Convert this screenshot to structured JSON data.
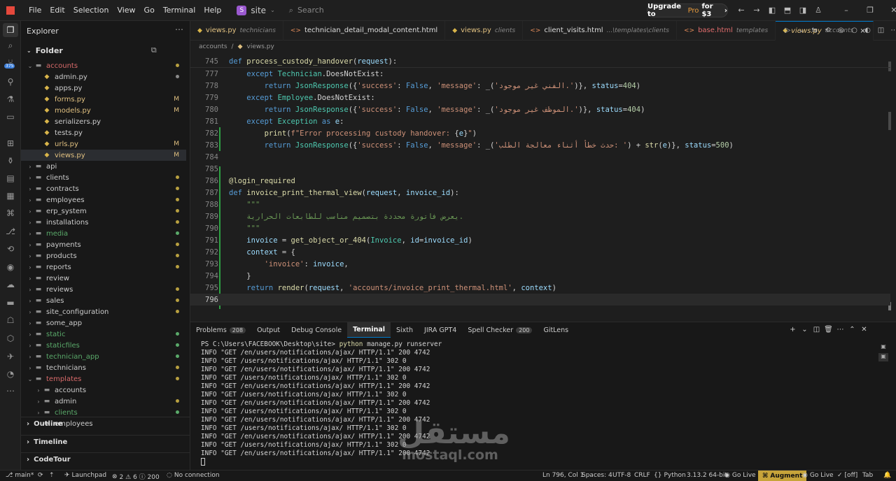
{
  "titlebar": {
    "menu": [
      "File",
      "Edit",
      "Selection",
      "View",
      "Go",
      "Terminal",
      "Help"
    ],
    "project_badge": "S",
    "project_name": "site",
    "search_placeholder": "Search",
    "upgrade_prefix": "Upgrade to",
    "upgrade_pro": "Pro",
    "upgrade_suffix": "for $3"
  },
  "activity": {
    "badge_count": "375"
  },
  "sidebar": {
    "title": "Explorer",
    "folder_label": "Folder",
    "rows": [
      {
        "name": "accounts",
        "type": "folder",
        "open": true,
        "indent": 1,
        "color": "#d86a6a",
        "status": "dot",
        "status_color": "#b8a040"
      },
      {
        "name": "admin.py",
        "type": "py",
        "indent": 2,
        "color": "#ccc",
        "status": "dot",
        "status_color": "#8a8a8a"
      },
      {
        "name": "apps.py",
        "type": "py",
        "indent": 2,
        "color": "#ccc",
        "status": ""
      },
      {
        "name": "forms.py",
        "type": "py",
        "indent": 2,
        "color": "#e0c080",
        "status": "M",
        "status_color": "#e0c080"
      },
      {
        "name": "models.py",
        "type": "py",
        "indent": 2,
        "color": "#e0c080",
        "status": "M",
        "status_color": "#e0c080"
      },
      {
        "name": "serializers.py",
        "type": "py",
        "indent": 2,
        "color": "#ccc",
        "status": ""
      },
      {
        "name": "tests.py",
        "type": "py",
        "indent": 2,
        "color": "#ccc",
        "status": ""
      },
      {
        "name": "urls.py",
        "type": "py",
        "indent": 2,
        "color": "#e0c080",
        "status": "M",
        "status_color": "#e0c080"
      },
      {
        "name": "views.py",
        "type": "py",
        "indent": 2,
        "color": "#e0c080",
        "status": "M",
        "status_color": "#e0c080",
        "selected": true
      },
      {
        "name": "api",
        "type": "folder",
        "indent": 1,
        "color": "#ccc",
        "status": ""
      },
      {
        "name": "clients",
        "type": "folder",
        "indent": 1,
        "color": "#ccc",
        "status": "dot",
        "status_color": "#b8a040"
      },
      {
        "name": "contracts",
        "type": "folder",
        "indent": 1,
        "color": "#ccc",
        "status": "dot",
        "status_color": "#b8a040"
      },
      {
        "name": "employees",
        "type": "folder",
        "indent": 1,
        "color": "#ccc",
        "status": "dot",
        "status_color": "#b8a040"
      },
      {
        "name": "erp_system",
        "type": "folder",
        "indent": 1,
        "color": "#ccc",
        "status": "dot",
        "status_color": "#b8a040"
      },
      {
        "name": "installations",
        "type": "folder",
        "indent": 1,
        "color": "#ccc",
        "status": "dot",
        "status_color": "#b8a040"
      },
      {
        "name": "media",
        "type": "folder",
        "indent": 1,
        "color": "#5aaa6a",
        "status": "dot",
        "status_color": "#5aaa6a"
      },
      {
        "name": "payments",
        "type": "folder",
        "indent": 1,
        "color": "#ccc",
        "status": "dot",
        "status_color": "#b8a040"
      },
      {
        "name": "products",
        "type": "folder",
        "indent": 1,
        "color": "#ccc",
        "status": "dot",
        "status_color": "#b8a040"
      },
      {
        "name": "reports",
        "type": "folder",
        "indent": 1,
        "color": "#ccc",
        "status": "dot",
        "status_color": "#b8a040"
      },
      {
        "name": "review",
        "type": "folder",
        "indent": 1,
        "color": "#ccc",
        "status": ""
      },
      {
        "name": "reviews",
        "type": "folder",
        "indent": 1,
        "color": "#ccc",
        "status": "dot",
        "status_color": "#b8a040"
      },
      {
        "name": "sales",
        "type": "folder",
        "indent": 1,
        "color": "#ccc",
        "status": "dot",
        "status_color": "#b8a040"
      },
      {
        "name": "site_configuration",
        "type": "folder",
        "indent": 1,
        "color": "#ccc",
        "status": "dot",
        "status_color": "#b8a040"
      },
      {
        "name": "some_app",
        "type": "folder",
        "indent": 1,
        "color": "#ccc",
        "status": ""
      },
      {
        "name": "static",
        "type": "folder",
        "indent": 1,
        "color": "#5aaa6a",
        "status": "dot",
        "status_color": "#5aaa6a"
      },
      {
        "name": "staticfiles",
        "type": "folder",
        "indent": 1,
        "color": "#5aaa6a",
        "status": "dot",
        "status_color": "#5aaa6a"
      },
      {
        "name": "technician_app",
        "type": "folder",
        "indent": 1,
        "color": "#5aaa6a",
        "status": "dot",
        "status_color": "#5aaa6a"
      },
      {
        "name": "technicians",
        "type": "folder",
        "indent": 1,
        "color": "#ccc",
        "status": "dot",
        "status_color": "#b8a040"
      },
      {
        "name": "templates",
        "type": "folder",
        "open": true,
        "indent": 1,
        "color": "#d86a6a",
        "status": "dot",
        "status_color": "#b8a040"
      },
      {
        "name": "accounts",
        "type": "folder",
        "indent": 2,
        "color": "#ccc",
        "status": ""
      },
      {
        "name": "admin",
        "type": "folder",
        "indent": 2,
        "color": "#ccc",
        "status": "dot",
        "status_color": "#b8a040"
      },
      {
        "name": "clients",
        "type": "folder",
        "indent": 2,
        "color": "#5aaa6a",
        "status": "dot",
        "status_color": "#5aaa6a"
      },
      {
        "name": "employees",
        "type": "folder",
        "indent": 2,
        "color": "#ccc",
        "status": ""
      }
    ],
    "sections": [
      "Outline",
      "Timeline",
      "CodeTour"
    ]
  },
  "tabs": [
    {
      "name": "views.py",
      "sub": "technicians",
      "color": "#e0c080",
      "icon": "py"
    },
    {
      "name": "technician_detail_modal_content.html",
      "sub": "",
      "color": "#ddd",
      "icon": "html"
    },
    {
      "name": "views.py",
      "sub": "clients",
      "color": "#e0c080",
      "icon": "py"
    },
    {
      "name": "client_visits.html",
      "sub": "...\\templates\\clients",
      "color": "#ddd",
      "icon": "html"
    },
    {
      "name": "base.html",
      "sub": "templates",
      "color": "#e06c6c",
      "icon": "html"
    },
    {
      "name": "views.py",
      "sub": "accounts",
      "color": "#e0c080",
      "icon": "py",
      "active": true,
      "close": "×"
    }
  ],
  "breadcrumb": [
    "accounts",
    "/",
    "views.py"
  ],
  "editor": {
    "lines": [
      {
        "n": "745",
        "html": "<span class='kw'>def</span> <span class='fn'>process_custody_handover</span>(<span class='var'>request</span>):",
        "sticky": true
      },
      {
        "n": "777",
        "html": "    <span class='kw'>except</span> <span class='cls'>Technician</span>.DoesNotExist:"
      },
      {
        "n": "778",
        "html": "        <span class='kw'>return</span> <span class='cls'>JsonResponse</span>({<span class='str'>'success'</span>: <span class='kw'>False</span>, <span class='str'>'message'</span>: _(<span class='str'>'الفني غير موجود.'</span>)}, <span class='var'>status</span>=<span class='num'>404</span>)"
      },
      {
        "n": "779",
        "html": "    <span class='kw'>except</span> <span class='cls'>Employee</span>.DoesNotExist:"
      },
      {
        "n": "780",
        "html": "        <span class='kw'>return</span> <span class='cls'>JsonResponse</span>({<span class='str'>'success'</span>: <span class='kw'>False</span>, <span class='str'>'message'</span>: _(<span class='str'>'الموظف غير موجود.'</span>)}, <span class='var'>status</span>=<span class='num'>404</span>)"
      },
      {
        "n": "781",
        "html": "    <span class='kw'>except</span> <span class='cls'>Exception</span> <span class='kw'>as</span> <span class='var'>e</span>:"
      },
      {
        "n": "782",
        "html": "        <span class='fn'>print</span>(<span class='str'>f\"Error processing custody handover: </span>{<span class='var'>e</span>}<span class='str'>\"</span>)"
      },
      {
        "n": "783",
        "html": "        <span class='kw'>return</span> <span class='cls'>JsonResponse</span>({<span class='str'>'success'</span>: <span class='kw'>False</span>, <span class='str'>'message'</span>: _(<span class='str'>'حدث خطأ أثناء معالجة الطلب: '</span>) + <span class='fn'>str</span>(<span class='var'>e</span>)}, <span class='var'>status</span>=<span class='num'>500</span>)"
      },
      {
        "n": "784",
        "html": ""
      },
      {
        "n": "785",
        "html": ""
      },
      {
        "n": "786",
        "html": "<span class='dec'>@login_required</span>"
      },
      {
        "n": "787",
        "html": "<span class='kw'>def</span> <span class='fn'>invoice_print_thermal_view</span>(<span class='var'>request</span>, <span class='var'>invoice_id</span>):"
      },
      {
        "n": "788",
        "html": "    <span class='com'>\"\"\"</span>"
      },
      {
        "n": "789",
        "html": "    <span class='com'>يعرض فاتورة محددة بتصميم مناسب للطابعات الحرارية.</span>"
      },
      {
        "n": "790",
        "html": "    <span class='com'>\"\"\"</span>"
      },
      {
        "n": "791",
        "html": "    <span class='var'>invoice</span> = <span class='fn'>get_object_or_404</span>(<span class='cls'>Invoice</span>, <span class='var'>id</span>=<span class='var'>invoice_id</span>)"
      },
      {
        "n": "792",
        "html": "    <span class='var'>context</span> = {"
      },
      {
        "n": "793",
        "html": "        <span class='str'>'invoice'</span>: <span class='var'>invoice</span>,"
      },
      {
        "n": "794",
        "html": "    }"
      },
      {
        "n": "795",
        "html": "    <span class='kw'>return</span> <span class='fn'>render</span>(<span class='var'>request</span>, <span class='str'>'accounts/invoice_print_thermal.html'</span>, <span class='var'>context</span>)"
      },
      {
        "n": "796",
        "html": "",
        "current": true
      }
    ]
  },
  "panel": {
    "tabs": [
      {
        "label": "Problems",
        "count": "208"
      },
      {
        "label": "Output",
        "count": ""
      },
      {
        "label": "Debug Console",
        "count": ""
      },
      {
        "label": "Terminal",
        "count": "",
        "active": true
      },
      {
        "label": "Sixth",
        "count": ""
      },
      {
        "label": "JIRA GPT4",
        "count": ""
      },
      {
        "label": "Spell Checker",
        "count": "200"
      },
      {
        "label": "GitLens",
        "count": ""
      }
    ],
    "prompt": "PS C:\\Users\\FACEBOOK\\Desktop\\site> ",
    "command": "python",
    "command_rest": " manage.py runserver",
    "log": [
      "INFO \"GET /en/users/notifications/ajax/ HTTP/1.1\" 200 4742",
      "INFO \"GET /users/notifications/ajax/ HTTP/1.1\" 302 0",
      "INFO \"GET /en/users/notifications/ajax/ HTTP/1.1\" 200 4742",
      "INFO \"GET /users/notifications/ajax/ HTTP/1.1\" 302 0",
      "INFO \"GET /en/users/notifications/ajax/ HTTP/1.1\" 200 4742",
      "INFO \"GET /users/notifications/ajax/ HTTP/1.1\" 302 0",
      "INFO \"GET /en/users/notifications/ajax/ HTTP/1.1\" 200 4742",
      "INFO \"GET /users/notifications/ajax/ HTTP/1.1\" 302 0",
      "INFO \"GET /en/users/notifications/ajax/ HTTP/1.1\" 200 4742",
      "INFO \"GET /users/notifications/ajax/ HTTP/1.1\" 302 0",
      "INFO \"GET /en/users/notifications/ajax/ HTTP/1.1\" 200 4742",
      "INFO \"GET /users/notifications/ajax/ HTTP/1.1\" 302 0",
      "INFO \"GET /en/users/notifications/ajax/ HTTP/1.1\" 200 4742"
    ]
  },
  "watermark": {
    "arabic": "مستقل",
    "latin": "mostaql.com"
  },
  "statusbar": {
    "branch": "main*",
    "launchpad": "Launchpad",
    "problems": "2 ⚠ 6 ⓘ 200",
    "connection": "No connection",
    "position": "Ln 796, Col 1",
    "spaces": "Spaces: 4",
    "encoding": "UTF-8",
    "eol": "CRLF",
    "language": "Python",
    "interpreter": "3.13.2 64-bit",
    "golive1": "Go Live",
    "augment": "Augment",
    "golive2": "Go Live",
    "off": "[off]",
    "tab": "Tab"
  }
}
